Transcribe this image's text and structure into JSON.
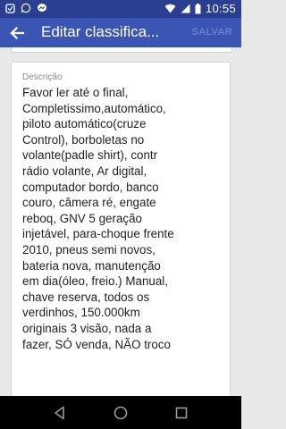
{
  "status_bar": {
    "time": "10:55",
    "left_icons": [
      "notification-icon",
      "whatsapp-icon",
      "messenger-icon"
    ],
    "right_icons": [
      "wifi-icon",
      "signal-icon",
      "battery-icon"
    ]
  },
  "app_bar": {
    "title": "Editar classifica...",
    "save_label": "SALVAR"
  },
  "description": {
    "label": "Descrição",
    "value": "Favor ler até o final,\nCompletissimo,automático,\npiloto automático(cruze\nControl), borboletas no\nvolante(padle shirt), contr\nrádio volante,  Ar digital,\ncomputador bordo, banco\ncouro, câmera ré, engate\nreboq, GNV 5 geração\ninjetável, para-choque frente\n2010, pneus semi novos,\nbateria nova, manutenção\nem dia(óleo, freio.) Manual,\nchave reserva, todos os\nverdinhos, 150.000km\noriginais 3 visão, nada a\nfazer, SÓ venda, NÃO troco"
  },
  "colors": {
    "status_bar": "#2a3f8f",
    "app_bar": "#3a55b4",
    "background": "#e8e8e8",
    "nav_bar": "#000000"
  },
  "nav_bar": {
    "buttons": [
      "back-triangle-icon",
      "home-circle-icon",
      "recents-square-icon"
    ]
  }
}
